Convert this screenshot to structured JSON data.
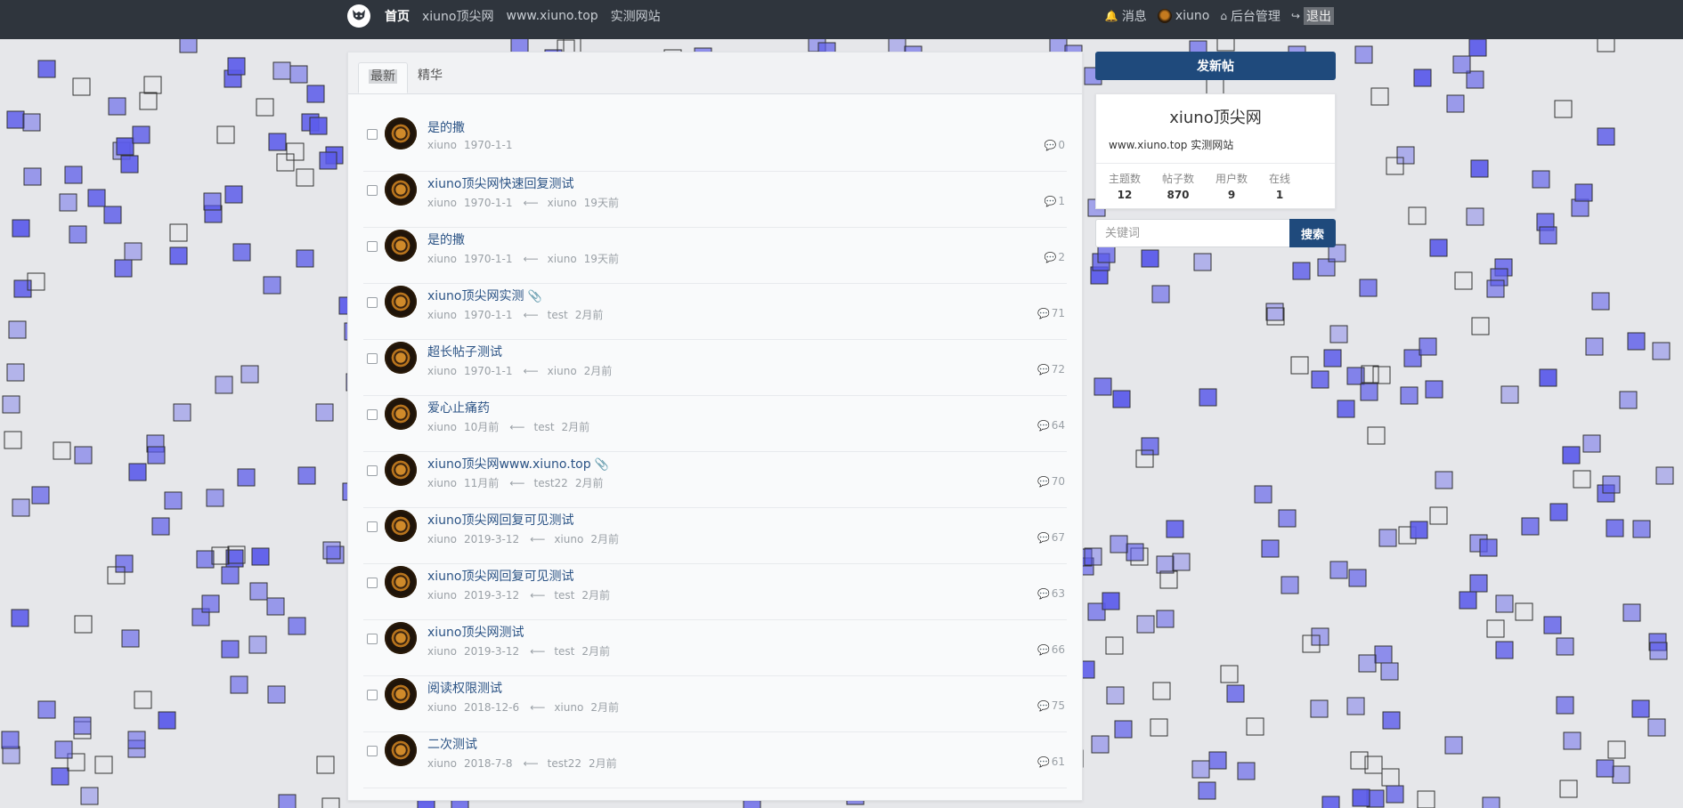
{
  "nav": {
    "links": [
      "首页",
      "xiuno顶尖网",
      "www.xiuno.top",
      "实测网站"
    ],
    "message": "消息",
    "user": "xiuno",
    "admin": "后台管理",
    "logout": "退出"
  },
  "tabs": [
    "最新",
    "精华"
  ],
  "threads": [
    {
      "title": "是的撒",
      "author": "xiuno",
      "date": "1970-1-1",
      "last_user": "",
      "last_time": "",
      "replies": "0",
      "attachment": false
    },
    {
      "title": "xiuno顶尖网快速回复测试",
      "author": "xiuno",
      "date": "1970-1-1",
      "last_user": "xiuno",
      "last_time": "19天前",
      "replies": "1",
      "attachment": false
    },
    {
      "title": "是的撒",
      "author": "xiuno",
      "date": "1970-1-1",
      "last_user": "xiuno",
      "last_time": "19天前",
      "replies": "2",
      "attachment": false
    },
    {
      "title": "xiuno顶尖网实测",
      "author": "xiuno",
      "date": "1970-1-1",
      "last_user": "test",
      "last_time": "2月前",
      "replies": "71",
      "attachment": true
    },
    {
      "title": "超长帖子测试",
      "author": "xiuno",
      "date": "1970-1-1",
      "last_user": "xiuno",
      "last_time": "2月前",
      "replies": "72",
      "attachment": false
    },
    {
      "title": "爱心止痛药",
      "author": "xiuno",
      "date": "10月前",
      "last_user": "test",
      "last_time": "2月前",
      "replies": "64",
      "attachment": false
    },
    {
      "title": "xiuno顶尖网www.xiuno.top",
      "author": "xiuno",
      "date": "11月前",
      "last_user": "test22",
      "last_time": "2月前",
      "replies": "70",
      "attachment": true
    },
    {
      "title": "xiuno顶尖网回复可见测试",
      "author": "xiuno",
      "date": "2019-3-12",
      "last_user": "xiuno",
      "last_time": "2月前",
      "replies": "67",
      "attachment": false
    },
    {
      "title": "xiuno顶尖网回复可见测试",
      "author": "xiuno",
      "date": "2019-3-12",
      "last_user": "test",
      "last_time": "2月前",
      "replies": "63",
      "attachment": false
    },
    {
      "title": "xiuno顶尖网测试",
      "author": "xiuno",
      "date": "2019-3-12",
      "last_user": "test",
      "last_time": "2月前",
      "replies": "66",
      "attachment": false
    },
    {
      "title": "阅读权限测试",
      "author": "xiuno",
      "date": "2018-12-6",
      "last_user": "xiuno",
      "last_time": "2月前",
      "replies": "75",
      "attachment": false
    },
    {
      "title": "二次测试",
      "author": "xiuno",
      "date": "2018-7-8",
      "last_user": "test22",
      "last_time": "2月前",
      "replies": "61",
      "attachment": false
    }
  ],
  "sidebar": {
    "new_thread_button": "发新帖",
    "site_name": "xiuno顶尖网",
    "site_desc": "www.xiuno.top 实测网站",
    "stats": [
      {
        "label": "主题数",
        "value": "12"
      },
      {
        "label": "帖子数",
        "value": "870"
      },
      {
        "label": "用户数",
        "value": "9"
      },
      {
        "label": "在线",
        "value": "1"
      }
    ],
    "search_placeholder": "关键词",
    "search_button": "搜索"
  },
  "colors": {
    "navbar": "#2f353d",
    "primary": "#1f4a7c",
    "link": "#2b5385",
    "square_fill": "#5b5bea"
  }
}
